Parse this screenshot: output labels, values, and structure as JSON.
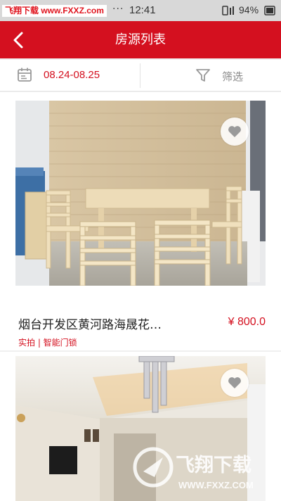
{
  "status_bar": {
    "watermark": "飞翔下载 www.FXXZ.com",
    "dots": "···",
    "time": "12:41",
    "battery": "94%"
  },
  "header": {
    "title": "房源列表",
    "back_icon": "chevron-left-icon"
  },
  "filter_bar": {
    "date_range": "08.24-08.25",
    "filter_label": "筛选",
    "date_icon": "calendar-icon",
    "filter_icon": "funnel-icon"
  },
  "listings": [
    {
      "title": "烟台开发区黄河路海晟花…",
      "price": "¥ 800.0",
      "tags": "实拍 | 智能门锁",
      "favorite_icon": "heart-icon"
    },
    {
      "title": "",
      "price": "",
      "tags": "",
      "favorite_icon": "heart-icon"
    }
  ],
  "watermark_bottom": {
    "brand": "飞翔下载",
    "url": "WWW.FXXZ.COM"
  },
  "colors": {
    "accent": "#d4101f",
    "status_bar": "#d8d8d8",
    "background": "#f0f0f0"
  }
}
